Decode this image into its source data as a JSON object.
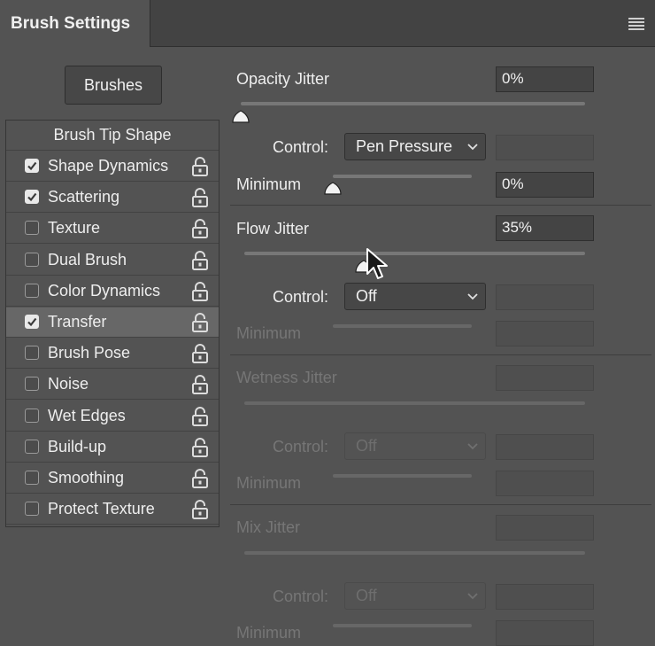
{
  "panel": {
    "title": "Brush Settings",
    "brushes_button": "Brushes"
  },
  "sidebar": {
    "header": "Brush Tip Shape",
    "items": [
      {
        "label": "Shape Dynamics",
        "checked": true
      },
      {
        "label": "Scattering",
        "checked": true
      },
      {
        "label": "Texture",
        "checked": false
      },
      {
        "label": "Dual Brush",
        "checked": false
      },
      {
        "label": "Color Dynamics",
        "checked": false
      },
      {
        "label": "Transfer",
        "checked": true,
        "selected": true
      },
      {
        "label": "Brush Pose",
        "checked": false
      },
      {
        "label": "Noise",
        "checked": false
      },
      {
        "label": "Wet Edges",
        "checked": false
      },
      {
        "label": "Build-up",
        "checked": false
      },
      {
        "label": "Smoothing",
        "checked": false
      },
      {
        "label": "Protect Texture",
        "checked": false
      }
    ]
  },
  "opacity": {
    "label": "Opacity Jitter",
    "value": "0%",
    "slider_percent": 0,
    "control_label": "Control:",
    "control_value": "Pen Pressure",
    "minimum_label": "Minimum",
    "minimum_value": "0%",
    "minimum_percent": 0
  },
  "flow": {
    "label": "Flow Jitter",
    "value": "35%",
    "slider_percent": 35,
    "control_label": "Control:",
    "control_value": "Off",
    "minimum_label": "Minimum"
  },
  "wetness": {
    "label": "Wetness Jitter",
    "control_label": "Control:",
    "control_value": "Off",
    "minimum_label": "Minimum"
  },
  "mix": {
    "label": "Mix Jitter",
    "control_label": "Control:",
    "control_value": "Off",
    "minimum_label": "Minimum"
  }
}
